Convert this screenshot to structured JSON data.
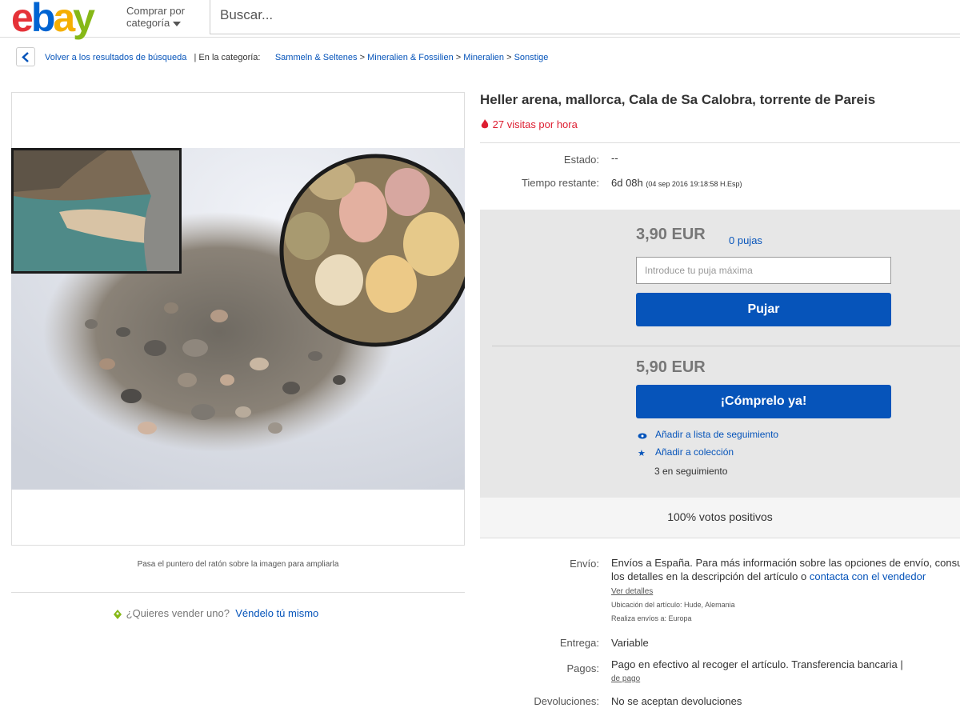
{
  "header": {
    "logo_letters": [
      "e",
      "b",
      "a",
      "y"
    ],
    "logo_colors": [
      "#e53238",
      "#0064d2",
      "#f5af02",
      "#86b817"
    ],
    "category_label_line1": "Comprar por",
    "category_label_line2": "categoría",
    "search_placeholder": "Buscar..."
  },
  "breadcrumb": {
    "back_label": "Volver a los resultados de búsqueda",
    "in_category": "| En la categoría:",
    "items": [
      "Sammeln & Seltenes",
      "Mineralien & Fossilien",
      "Mineralien",
      "Sonstige"
    ],
    "separator": ">"
  },
  "gallery": {
    "hover_caption": "Pasa el puntero del ratón sobre la imagen para ampliarla"
  },
  "sell": {
    "question": "¿Quieres vender uno?",
    "link": "Véndelo tú mismo"
  },
  "item": {
    "title": "Heller arena, mallorca, Cala de Sa Calobra, torrente de Pareis",
    "views": "27 visitas por hora",
    "condition_label": "Estado:",
    "condition_value": "--",
    "time_label": "Tiempo restante:",
    "time_value": "6d 08h",
    "time_detail": "(04 sep 2016   19:18:58 H.Esp)"
  },
  "buybox": {
    "bid_price": "3,90 EUR",
    "bids": "0 pujas",
    "bid_placeholder": "Introduce tu puja máxima",
    "bid_button": "Pujar",
    "buy_price": "5,90 EUR",
    "buy_button": "¡Cómprelo ya!",
    "watch_link": "Añadir a lista de seguimiento",
    "collection_link": "Añadir a colección",
    "following": "3 en seguimiento",
    "feedback": "100% votos positivos",
    "accent": "#0654ba"
  },
  "details": {
    "shipping_label": "Envío:",
    "shipping_line1": "Envíos a España. Para más información sobre las opciones de envío, consulta",
    "shipping_line2_prefix": "los detalles en la descripción del artículo o",
    "shipping_contact": "contacta con el vendedor",
    "see_details": "Ver detalles",
    "location": "Ubicación del artículo:  Hude, Alemania",
    "ships_to": "Realiza envíos a:  Europa",
    "delivery_label": "Entrega:",
    "delivery_value": "Variable",
    "payments_label": "Pagos:",
    "payments_value": "Pago en efectivo al recoger el artículo.  Transferencia bancaria  |",
    "payments_link": "de pago",
    "returns_label": "Devoluciones:",
    "returns_value": "No se aceptan devoluciones"
  }
}
